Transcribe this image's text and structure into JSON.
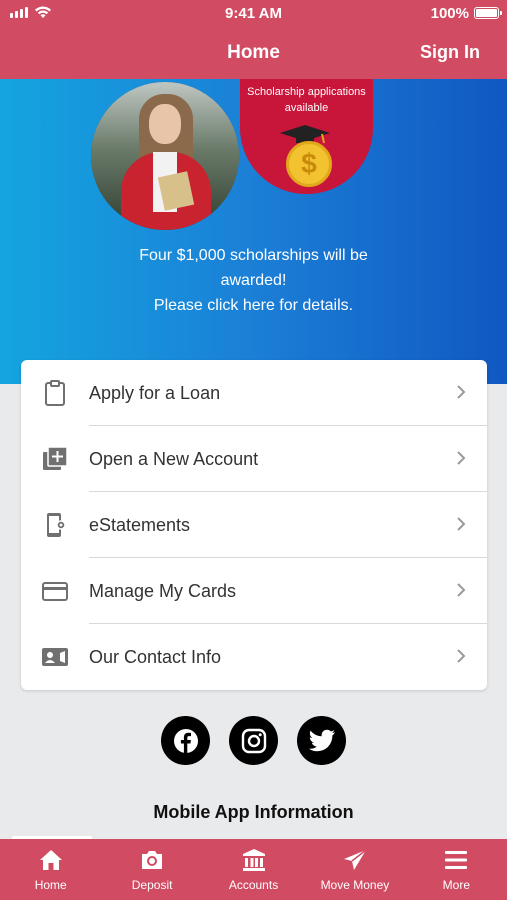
{
  "status_bar": {
    "time": "9:41 AM",
    "battery": "100%"
  },
  "header": {
    "title": "Home",
    "sign_in": "Sign In"
  },
  "banner": {
    "badge_text": "Scholarship applications available",
    "coin_symbol": "$",
    "line1": "Four $1,000 scholarships will be",
    "line2": "awarded!",
    "line3": "Please click here for details."
  },
  "menu": {
    "items": [
      {
        "label": "Apply for a Loan",
        "icon": "clipboard-icon"
      },
      {
        "label": "Open a New Account",
        "icon": "add-account-icon"
      },
      {
        "label": "eStatements",
        "icon": "phone-settings-icon"
      },
      {
        "label": "Manage My Cards",
        "icon": "credit-card-icon"
      },
      {
        "label": "Our Contact Info",
        "icon": "contact-card-icon"
      }
    ]
  },
  "social": [
    "facebook-icon",
    "instagram-icon",
    "twitter-icon"
  ],
  "footer": {
    "mobile_info": "Mobile App Information"
  },
  "tabs": [
    {
      "label": "Home",
      "icon": "home-icon"
    },
    {
      "label": "Deposit",
      "icon": "camera-icon"
    },
    {
      "label": "Accounts",
      "icon": "bank-icon"
    },
    {
      "label": "Move Money",
      "icon": "send-icon"
    },
    {
      "label": "More",
      "icon": "menu-icon"
    }
  ],
  "colors": {
    "brand": "#d14b62",
    "badge": "#c8153a",
    "banner_start": "#14a5e0",
    "banner_end": "#1058c2"
  }
}
